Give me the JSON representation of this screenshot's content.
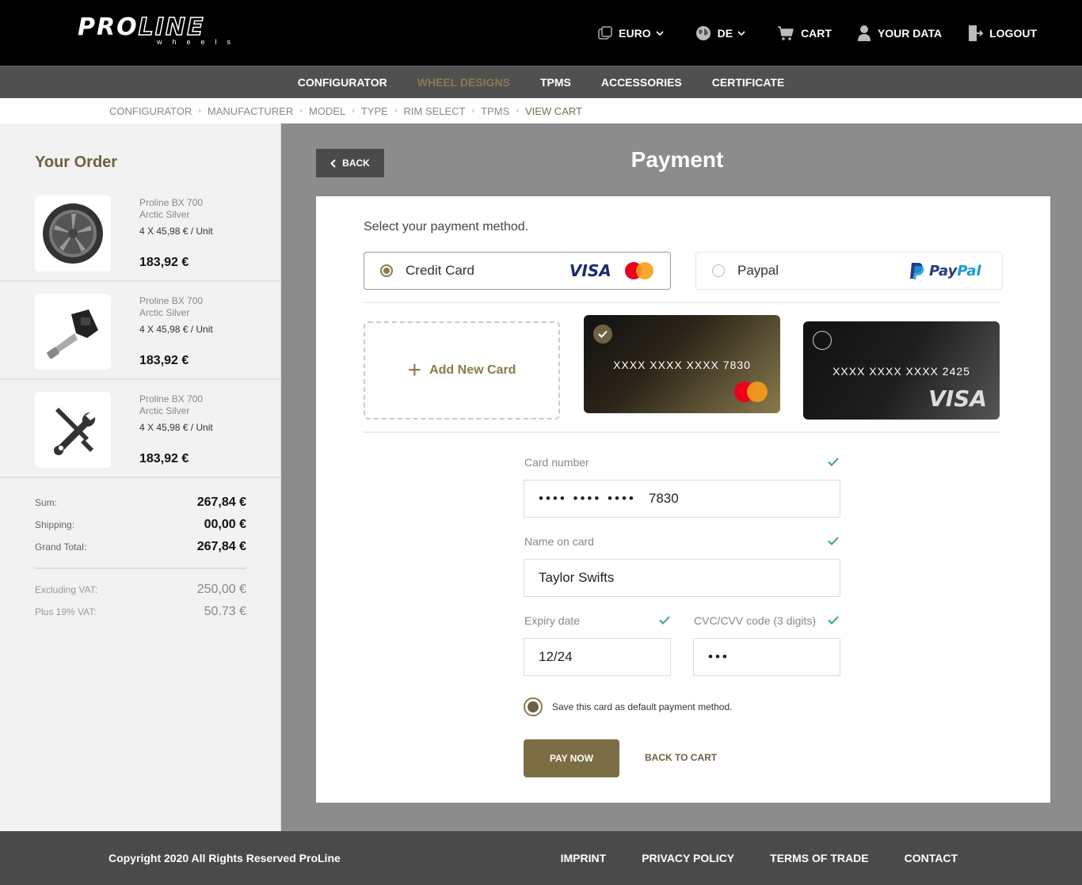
{
  "brand": {
    "logo_main": "PROLINE",
    "logo_sub": "wheels"
  },
  "topnav": {
    "currency": "EURO",
    "language": "DE",
    "cart": "CART",
    "your_data": "YOUR DATA",
    "logout": "LOGOUT"
  },
  "catnav": {
    "items": [
      "CONFIGURATOR",
      "WHEEL DESIGNS",
      "TPMS",
      "ACCESSORIES",
      "CERTIFICATE"
    ],
    "active": "WHEEL DESIGNS"
  },
  "breadcrumb": [
    "CONFIGURATOR",
    "MANUFACTURER",
    "MODEL",
    "TYPE",
    "RIM SELECT",
    "TPMS",
    "VIEW CART"
  ],
  "order": {
    "title": "Your Order",
    "items": [
      {
        "name": "Proline BX 700",
        "variant": "Arctic Silver",
        "qty": "4 X 45,98 € / Unit",
        "price": "183,92 €",
        "icon": "wheel-icon"
      },
      {
        "name": "Proline BX 700",
        "variant": "Arctic Silver",
        "qty": "4 X 45,98 € / Unit",
        "price": "183,92 €",
        "icon": "tpms-sensor-icon"
      },
      {
        "name": "Proline BX 700",
        "variant": "Arctic Silver",
        "qty": "4 X 45,98 € / Unit",
        "price": "183,92 €",
        "icon": "tools-icon"
      }
    ],
    "sum_label": "Sum:",
    "sum": "267,84 €",
    "shipping_label": "Shipping:",
    "shipping": "00,00 €",
    "grand_label": "Grand Total:",
    "grand": "267,84 €",
    "excl_vat_label": "Excluding VAT:",
    "excl_vat": "250,00 €",
    "vat_label": "Plus 19% VAT:",
    "vat": "50.73 €"
  },
  "main": {
    "back": "BACK",
    "title": "Payment",
    "select_label": "Select your payment method.",
    "method_credit": "Credit Card",
    "method_paypal": "Paypal",
    "visa_logo": "VISA",
    "paypal_logo_a": "Pay",
    "paypal_logo_b": "Pal",
    "add_card": "Add New Card",
    "cards": [
      {
        "number": "XXXX  XXXX  XXXX  7830",
        "brand": "mastercard",
        "selected": true
      },
      {
        "number": "XXXX  XXXX  XXXX  2425",
        "brand": "VISA",
        "selected": false
      }
    ],
    "card_number_label": "Card number",
    "card_number_masked": "••••   ••••   ••••",
    "card_number_last": "7830",
    "name_label": "Name on card",
    "name_value": "Taylor Swifts",
    "expiry_label": "Expiry date",
    "expiry_value": "12/24",
    "cvc_label": "CVC/CVV code (3 digits)",
    "cvc_value": "•••",
    "save_default": "Save this card as default payment method.",
    "pay_now": "PAY NOW",
    "back_to_cart": "BACK TO CART"
  },
  "footer": {
    "copyright": "Copyright 2020 All Rights Reserved ProLine",
    "links": [
      "IMPRINT",
      "PRIVACY POLICY",
      "TERMS OF TRADE",
      "CONTACT"
    ]
  },
  "colors": {
    "accent": "#8a7a4c",
    "dark": "#000000",
    "nav": "#505050",
    "bg": "#8c8c8c"
  }
}
